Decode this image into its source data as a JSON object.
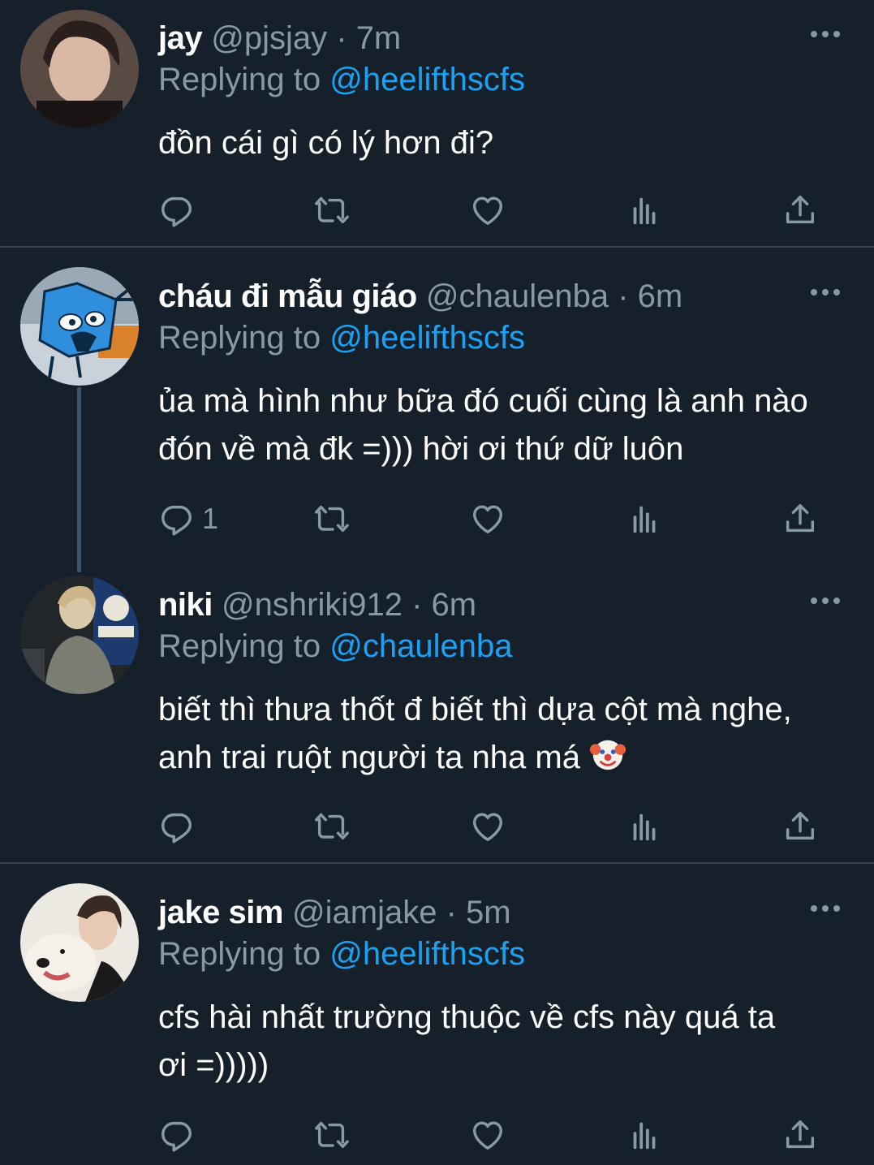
{
  "colors": {
    "background": "#15202b",
    "text": "#ffffff",
    "secondary": "#8899a6",
    "accent": "#1da1f2",
    "divider": "#38444d"
  },
  "tweets": [
    {
      "name": "jay",
      "handle": "@pjsjay",
      "separator": "·",
      "time": "7m",
      "replying_label": "Replying to",
      "replying_to": "@heelifthscfs",
      "text": "đồn cái gì có lý hơn đi?",
      "reply_count": ""
    },
    {
      "name": "cháu đi mẫu giáo",
      "handle": "@chaulenba",
      "separator": "·",
      "time": "6m",
      "replying_label": "Replying to",
      "replying_to": "@heelifthscfs",
      "text_line1": "ủa mà hình như bữa đó cuối cùng là anh nào",
      "text_line2": "đón về mà đk =))) hời ơi thứ dữ luôn",
      "reply_count": "1"
    },
    {
      "name": "niki",
      "handle": "@nshriki912",
      "separator": "·",
      "time": "6m",
      "replying_label": "Replying to",
      "replying_to": "@chaulenba",
      "text_line1": "biết thì thưa thốt đ biết thì dựa cột mà nghe,",
      "text_line2": "anh trai ruột người ta nha má",
      "emoji": "clown-face-emoji",
      "reply_count": ""
    },
    {
      "name": "jake sim",
      "handle": "@iamjake",
      "separator": "·",
      "time": "5m",
      "replying_label": "Replying to",
      "replying_to": "@heelifthscfs",
      "text_line1": "cfs hài nhất trường thuộc về cfs này quá ta",
      "text_line2": "ơi =)))))",
      "reply_count": ""
    }
  ],
  "icons": [
    "more-icon",
    "reply-icon",
    "retweet-icon",
    "like-icon",
    "analytics-icon",
    "share-icon"
  ]
}
